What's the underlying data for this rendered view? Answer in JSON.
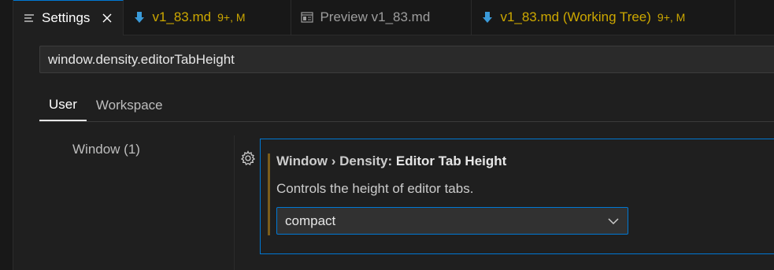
{
  "tabs": [
    {
      "label": "Settings",
      "icon": "settings-editor-icon",
      "active": true
    },
    {
      "label": "v1_83.md",
      "suffix": "9+, M",
      "icon": "markdown-download-icon",
      "modified": true
    },
    {
      "label": "Preview v1_83.md",
      "icon": "preview-icon"
    },
    {
      "label": "v1_83.md (Working Tree)",
      "suffix": "9+, M",
      "icon": "markdown-download-icon",
      "modified": true
    }
  ],
  "search": {
    "value": "window.density.editorTabHeight"
  },
  "scope_tabs": [
    {
      "label": "User",
      "active": true
    },
    {
      "label": "Workspace"
    }
  ],
  "toc": {
    "items": [
      {
        "label": "Window (1)"
      }
    ]
  },
  "setting": {
    "category": "Window › Density:",
    "key": "Editor Tab Height",
    "description": "Controls the height of editor tabs.",
    "value": "compact"
  },
  "colors": {
    "accent": "#0078d4",
    "modified": "#cca700",
    "background": "#1f1f1f"
  }
}
